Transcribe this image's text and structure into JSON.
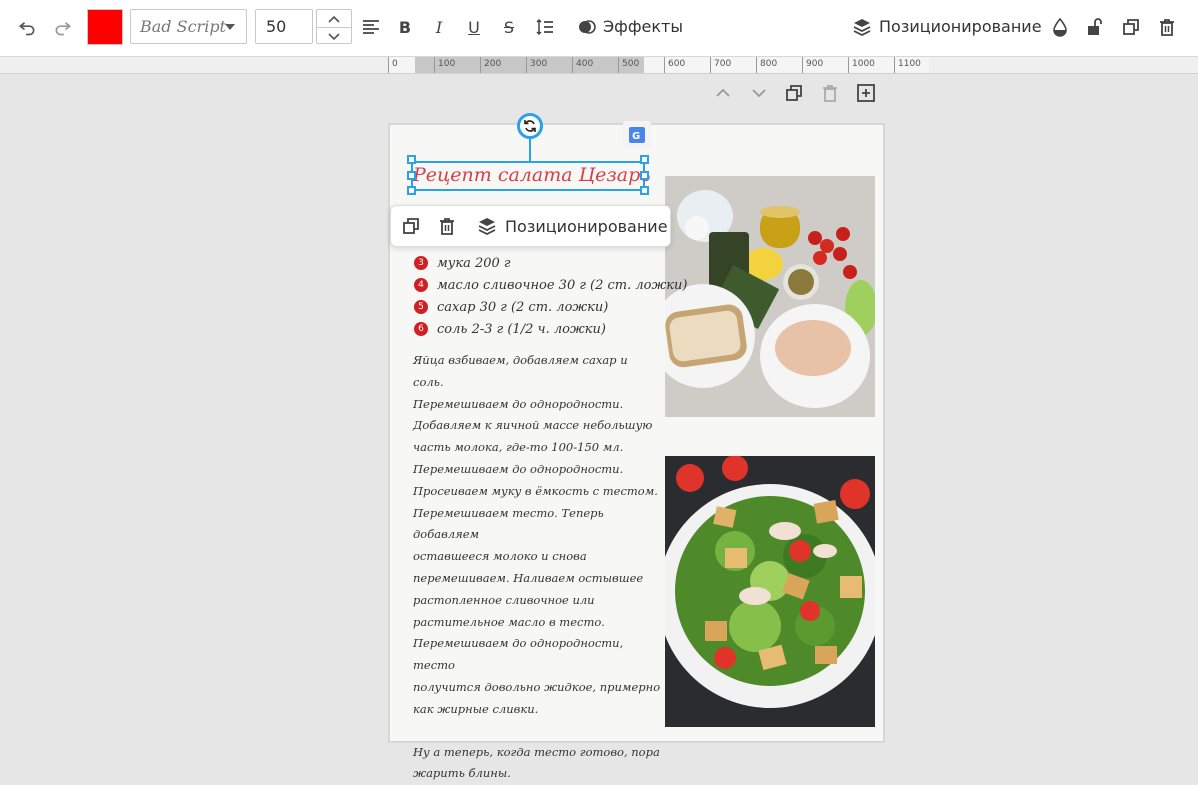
{
  "toolbar": {
    "color": "#ff0000",
    "font": "Bad Script",
    "size": "50",
    "effects": "Эффекты",
    "positioning": "Позиционирование"
  },
  "ruler": [
    "0",
    "100",
    "200",
    "300",
    "400",
    "500",
    "600",
    "700",
    "800",
    "900",
    "1000",
    "1100"
  ],
  "title": "Рецепт салата Цезарь",
  "context_menu": {
    "positioning": "Позиционирование"
  },
  "ingredients": [
    {
      "n": "3",
      "text": "мука  200 г"
    },
    {
      "n": "4",
      "text": "масло сливочное 30 г (2 ст. ложки)"
    },
    {
      "n": "5",
      "text": "сахар  30 г (2 ст. ложки)"
    },
    {
      "n": "6",
      "text": "соль  2-3 г (1/2 ч. ложки)"
    }
  ],
  "body": [
    "Яйца взбиваем, добавляем сахар и соль.",
    "Перемешиваем до однородности.",
    "Добавляем к яичной массе небольшую",
    "часть молока, где-то 100-150 мл.",
    "Перемешиваем до однородности.",
    "Просеиваем муку в ёмкость с тестом.",
    "Перемешиваем тесто. Теперь добавляем",
    "оставшееся молоко и снова",
    "перемешиваем. Наливаем остывшее",
    "растопленное сливочное или",
    "растительное масло в тесто.",
    "Перемешиваем до однородности, тесто",
    "получится довольно жидкое, примерно",
    "как жирные сливки."
  ],
  "body_end": [
    "Ну а теперь, когда тесто готово, пора",
    "жарить блины."
  ]
}
